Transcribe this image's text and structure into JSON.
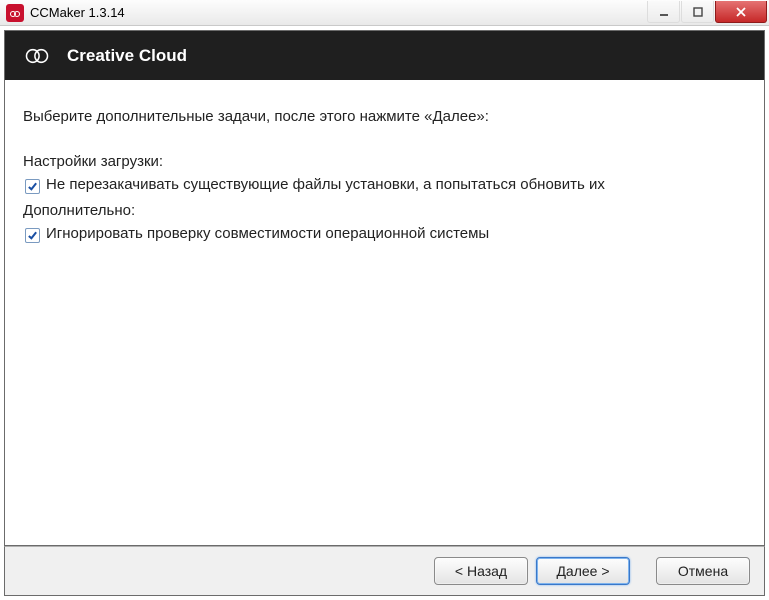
{
  "window": {
    "title": "CCMaker 1.3.14"
  },
  "header": {
    "title": "Creative Cloud"
  },
  "content": {
    "instruction": "Выберите дополнительные задачи, после этого нажмите «Далее»:",
    "section_download": "Настройки загрузки:",
    "checkbox_download": "Не перезакачивать существующие файлы установки, а попытаться обновить их",
    "section_additional": "Дополнительно:",
    "checkbox_ignorecompat": "Игнорировать проверку совместимости операционной системы"
  },
  "footer": {
    "back": "< Назад",
    "next": "Далее >",
    "cancel": "Отмена"
  }
}
